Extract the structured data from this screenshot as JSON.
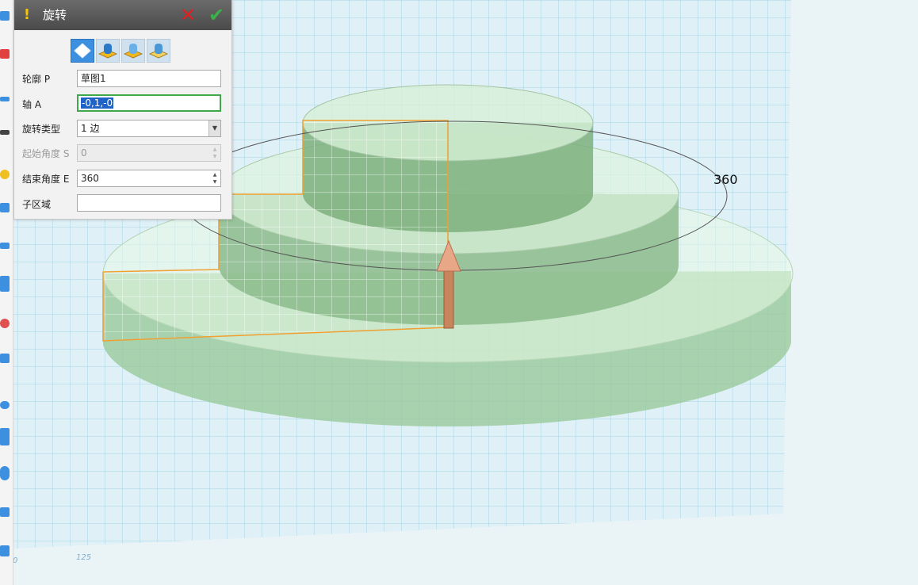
{
  "dialog": {
    "title": "旋转",
    "warning_icon": "exclamation-icon",
    "cancel_icon": "red-x-icon",
    "confirm_icon": "green-check-icon",
    "mode_buttons": [
      {
        "icon": "new-body-icon",
        "active": true
      },
      {
        "icon": "add-boolean-icon",
        "active": false
      },
      {
        "icon": "subtract-boolean-icon",
        "active": false
      },
      {
        "icon": "intersect-boolean-icon",
        "active": false
      }
    ],
    "fields": {
      "profile": {
        "label": "轮廓 P",
        "value": "草图1"
      },
      "axis": {
        "label": "轴 A",
        "value": "-0,1,-0"
      },
      "rotation_type": {
        "label": "旋转类型",
        "value": "1 边"
      },
      "start_angle": {
        "label": "起始角度 S",
        "value": "0"
      },
      "end_angle": {
        "label": "结束角度 E",
        "value": "360"
      },
      "subregion": {
        "label": "子区域",
        "value": ""
      }
    }
  },
  "viewport": {
    "dimension_label": "360",
    "tick_labels": [
      "0",
      "125"
    ],
    "colors": {
      "grid": "#a6d4e6",
      "body_fill": "#9ccc9c",
      "profile_outline": "#f0a030",
      "axis_arrow": "#c8845a"
    }
  }
}
